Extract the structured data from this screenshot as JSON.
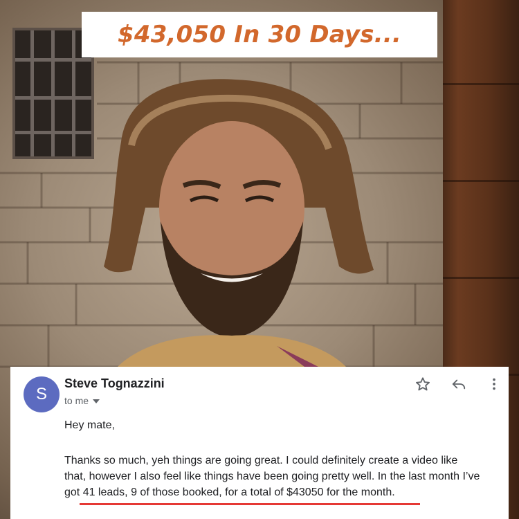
{
  "banner": {
    "title": "$43,050 In 30 Days..."
  },
  "email": {
    "avatar_letter": "S",
    "sender_name": "Steve Tognazzini",
    "recipient": "to me",
    "greeting": "Hey mate,",
    "body_line_1": "Thanks so much, yeh things are going great. I could definitely create a video like",
    "body_line_2": "that, however I also feel like things have been going pretty well. In the last month I’ve",
    "body_line_3": "got 41 leads, 9 of those booked, for a total of $43050 for the month.",
    "actions": {
      "star": "star-icon",
      "reply": "reply-icon",
      "more": "more-vert-icon"
    }
  },
  "colors": {
    "title_orange": "#d2682c",
    "avatar_blue": "#5c6bc0",
    "underline_red": "#e53935"
  }
}
